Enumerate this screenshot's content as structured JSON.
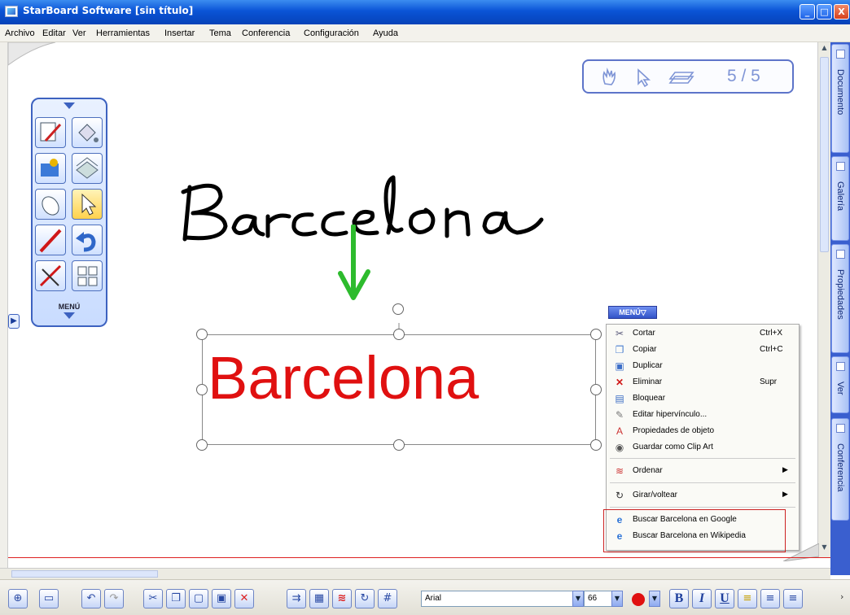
{
  "window": {
    "title": "StarBoard Software [sin título]",
    "minimize": "_",
    "maximize": "□",
    "close": "X"
  },
  "menubar": [
    "Archivo",
    "Editar",
    "Ver",
    "Herramientas",
    "Insertar",
    "Tema",
    "Conferencia",
    "Configuración",
    "Ayuda"
  ],
  "page_indicator": {
    "text": "5 / 5"
  },
  "palette": {
    "menu_label": "MENÚ"
  },
  "canvas": {
    "handwritten_text": "Barcelona",
    "text_object": "Barcelona",
    "colors": {
      "text_object": "#e01010",
      "arrow": "#2dbb2d",
      "handwriting": "#000000"
    }
  },
  "context_menu": {
    "badge": "MENÚ▽",
    "items": [
      {
        "label": "Cortar",
        "shortcut": "Ctrl+X",
        "icon": "scissors-icon"
      },
      {
        "label": "Copiar",
        "shortcut": "Ctrl+C",
        "icon": "copy-icon"
      },
      {
        "label": "Duplicar",
        "shortcut": "",
        "icon": "duplicate-icon"
      },
      {
        "label": "Eliminar",
        "shortcut": "Supr",
        "icon": "delete-x-icon"
      },
      {
        "label": "Bloquear",
        "shortcut": "",
        "icon": "lock-icon"
      },
      {
        "label": "Editar hipervínculo...",
        "shortcut": "",
        "icon": "hyperlink-icon"
      },
      {
        "label": "Propiedades de objeto",
        "shortcut": "",
        "icon": "properties-icon"
      },
      {
        "label": "Guardar como Clip Art",
        "shortcut": "",
        "icon": "clipart-icon"
      },
      {
        "label": "Ordenar",
        "shortcut": "",
        "icon": "order-icon",
        "submenu": true
      },
      {
        "label": "Girar/voltear",
        "shortcut": "",
        "icon": "rotate-icon",
        "submenu": true
      },
      {
        "label": "Buscar Barcelona en Google",
        "shortcut": "",
        "icon": "ie-icon"
      },
      {
        "label": "Buscar Barcelona en Wikipedia",
        "shortcut": "",
        "icon": "ie-icon"
      }
    ]
  },
  "side_tabs": [
    "Documento",
    "Galería",
    "Propiedades",
    "Ver",
    "Conferencia"
  ],
  "toolbar": {
    "font": "Arial",
    "size": "66",
    "bold": "B",
    "italic": "I",
    "underline": "U"
  }
}
